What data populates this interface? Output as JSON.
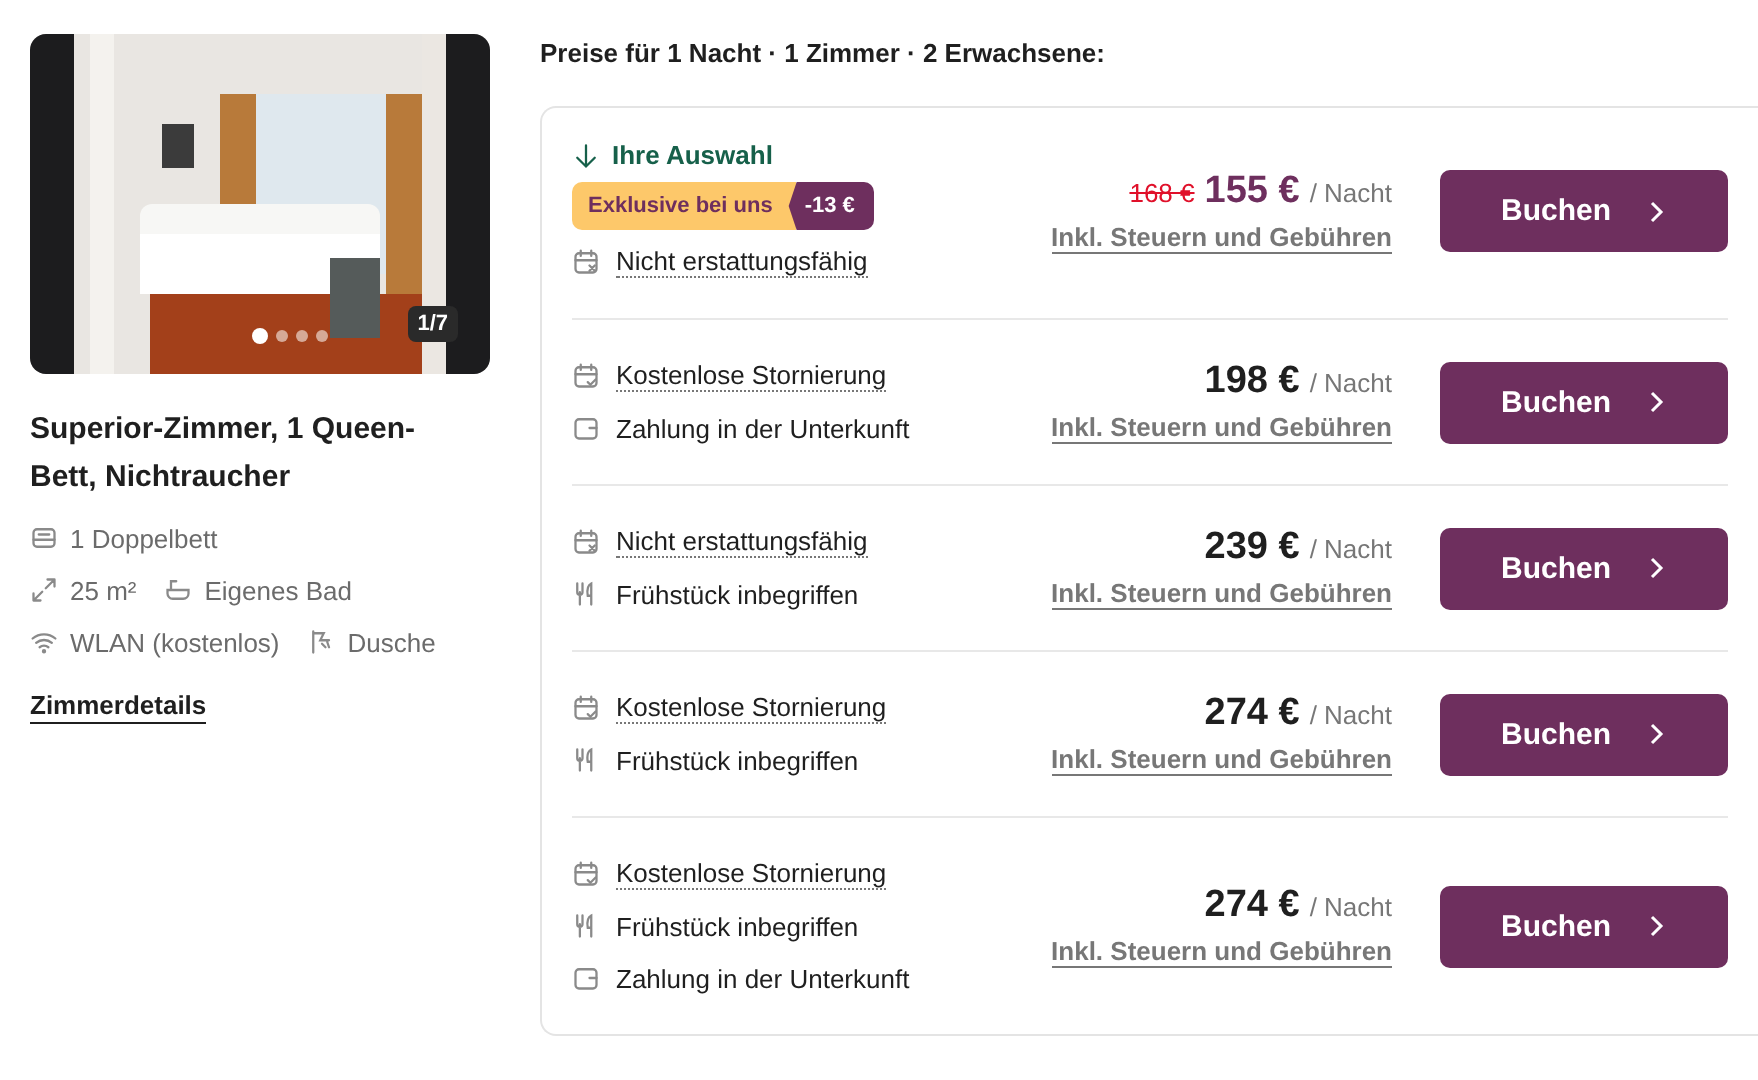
{
  "room": {
    "photo": {
      "counter": "1/7",
      "dots": [
        {
          "selected": true
        },
        {
          "selected": false
        },
        {
          "selected": false
        },
        {
          "selected": false
        }
      ]
    },
    "title": "Superior-Zimmer, 1 Queen-Bett, Nichtraucher",
    "amenities": [
      [
        {
          "kind": "bed",
          "label": "1 Doppelbett"
        }
      ],
      [
        {
          "kind": "size",
          "label": "25 m²"
        },
        {
          "kind": "bath",
          "label": "Eigenes Bad"
        }
      ],
      [
        {
          "kind": "wifi",
          "label": "WLAN (kostenlos)"
        },
        {
          "kind": "shower",
          "label": "Dusche"
        }
      ]
    ],
    "details_link": "Zimmerdetails"
  },
  "offers_heading": "Preise für 1 Nacht · 1 Zimmer · 2 Erwachsene:",
  "offers": [
    {
      "selected": true,
      "selection_label": "Ihre Auswahl",
      "badge": {
        "label": "Exklusive bei uns",
        "discount": "-13 €"
      },
      "features": [
        {
          "kind": "non-refundable",
          "label": "Nicht erstattungsfähig"
        }
      ],
      "old_price": "168 €",
      "price": "155 €",
      "per": "/ Nacht",
      "taxes": "Inkl. Steuern und Gebühren",
      "button": "Buchen"
    },
    {
      "selected": false,
      "features": [
        {
          "kind": "free-cancel",
          "label": "Kostenlose Stornierung"
        },
        {
          "kind": "pay-later",
          "label": "Zahlung in der Unterkunft"
        }
      ],
      "price": "198 €",
      "per": "/ Nacht",
      "taxes": "Inkl. Steuern und Gebühren",
      "button": "Buchen"
    },
    {
      "selected": false,
      "features": [
        {
          "kind": "non-refundable",
          "label": "Nicht erstattungsfähig"
        },
        {
          "kind": "breakfast",
          "label": "Frühstück inbegriffen"
        }
      ],
      "price": "239 €",
      "per": "/ Nacht",
      "taxes": "Inkl. Steuern und Gebühren",
      "button": "Buchen"
    },
    {
      "selected": false,
      "features": [
        {
          "kind": "free-cancel",
          "label": "Kostenlose Stornierung"
        },
        {
          "kind": "breakfast",
          "label": "Frühstück inbegriffen"
        }
      ],
      "price": "274 €",
      "per": "/ Nacht",
      "taxes": "Inkl. Steuern und Gebühren",
      "button": "Buchen"
    },
    {
      "selected": false,
      "features": [
        {
          "kind": "free-cancel",
          "label": "Kostenlose Stornierung"
        },
        {
          "kind": "breakfast",
          "label": "Frühstück inbegriffen"
        },
        {
          "kind": "pay-later",
          "label": "Zahlung in der Unterkunft"
        }
      ],
      "price": "274 €",
      "per": "/ Nacht",
      "taxes": "Inkl. Steuern und Gebühren",
      "button": "Buchen"
    }
  ]
}
